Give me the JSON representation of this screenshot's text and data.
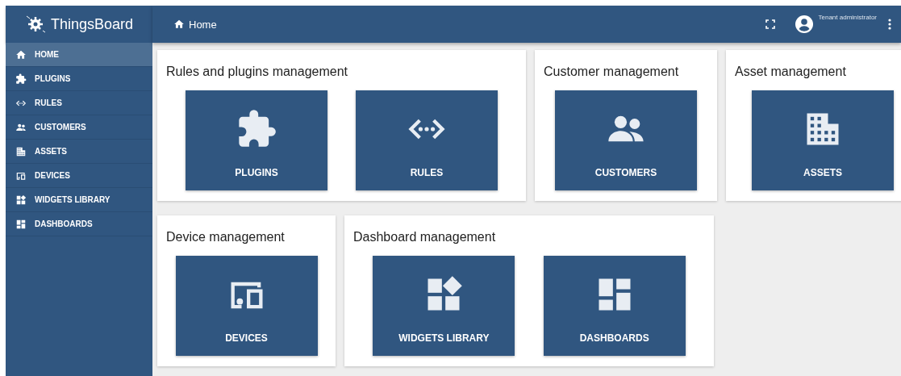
{
  "app": {
    "name": "ThingsBoard"
  },
  "toolbar": {
    "title": "Home",
    "user": "Tenant administrator"
  },
  "sidebar": {
    "items": [
      {
        "label": "HOME",
        "kind": "home",
        "selected": true
      },
      {
        "label": "PLUGINS",
        "kind": "plugins",
        "selected": false
      },
      {
        "label": "RULES",
        "kind": "rules",
        "selected": false
      },
      {
        "label": "CUSTOMERS",
        "kind": "customers",
        "selected": false
      },
      {
        "label": "ASSETS",
        "kind": "assets",
        "selected": false
      },
      {
        "label": "DEVICES",
        "kind": "devices",
        "selected": false
      },
      {
        "label": "WIDGETS LIBRARY",
        "kind": "widgets",
        "selected": false
      },
      {
        "label": "DASHBOARDS",
        "kind": "dashboards",
        "selected": false
      }
    ]
  },
  "cards": [
    [
      {
        "title": "Rules and plugins management",
        "tiles": [
          {
            "label": "PLUGINS",
            "kind": "plugins"
          },
          {
            "label": "RULES",
            "kind": "rules"
          }
        ]
      },
      {
        "title": "Customer management",
        "tiles": [
          {
            "label": "CUSTOMERS",
            "kind": "customers"
          }
        ]
      },
      {
        "title": "Asset management",
        "tiles": [
          {
            "label": "ASSETS",
            "kind": "assets"
          }
        ]
      }
    ],
    [
      {
        "title": "Device management",
        "tiles": [
          {
            "label": "DEVICES",
            "kind": "devices"
          }
        ]
      },
      {
        "title": "Dashboard management",
        "tiles": [
          {
            "label": "WIDGETS LIBRARY",
            "kind": "widgets"
          },
          {
            "label": "DASHBOARDS",
            "kind": "dashboards"
          }
        ]
      }
    ]
  ]
}
